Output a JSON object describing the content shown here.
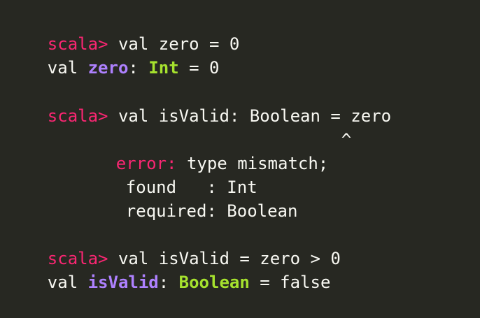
{
  "terminal": {
    "lines": [
      {
        "prompt": "scala>",
        "text": " val zero = 0"
      },
      {
        "kw": "val ",
        "ident": "zero",
        "sep": ": ",
        "type": "Int",
        "rest": " = 0"
      },
      {
        "prompt": "scala>",
        "text": " val isValid: Boolean = zero"
      },
      {
        "caret": "^"
      },
      {
        "err_label": "error:",
        "err_text": " type mismatch;"
      },
      {
        "text": "found   : Int"
      },
      {
        "text": "required: Boolean"
      },
      {
        "prompt": "scala>",
        "text": " val isValid = zero > 0"
      },
      {
        "kw": "val ",
        "ident": "isValid",
        "sep": ": ",
        "type": "Boolean",
        "rest": " = false"
      }
    ]
  }
}
